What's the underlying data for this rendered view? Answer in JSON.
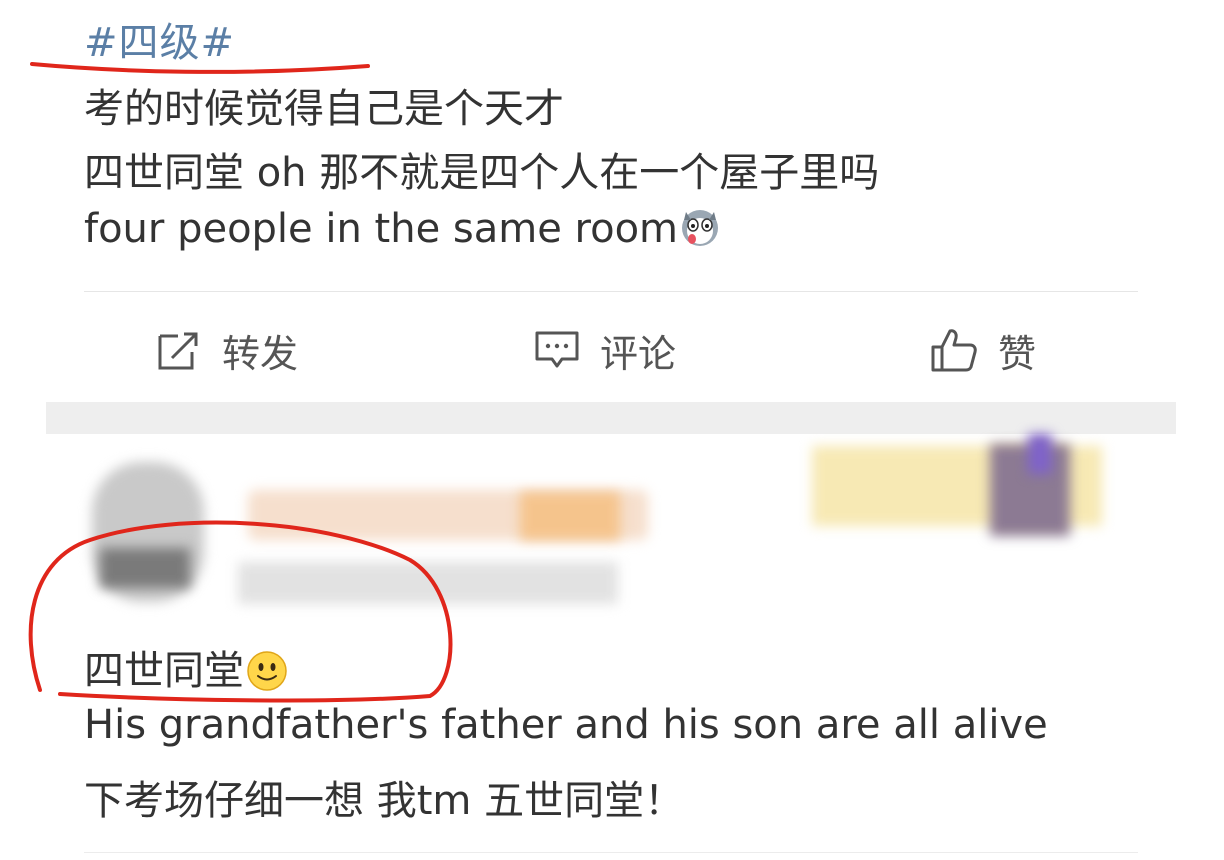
{
  "post": {
    "hashtag": "#四级#",
    "lines": [
      "考的时候觉得自己是个天才",
      "四世同堂 oh 那不就是四个人在一个屋子里吗",
      "four people in the same room"
    ],
    "emoji": "husky-emoji"
  },
  "actions": {
    "repost_label": "转发",
    "comment_label": "评论",
    "like_label": "赞"
  },
  "comment": {
    "lines": [
      "四世同堂",
      "His grandfather's father and his son are all alive",
      "下考场仔细一想 我tm 五世同堂！"
    ],
    "emoji": "smile-emoji"
  },
  "annotation_color": "#e0261b",
  "link_color": "#5b7fa6"
}
